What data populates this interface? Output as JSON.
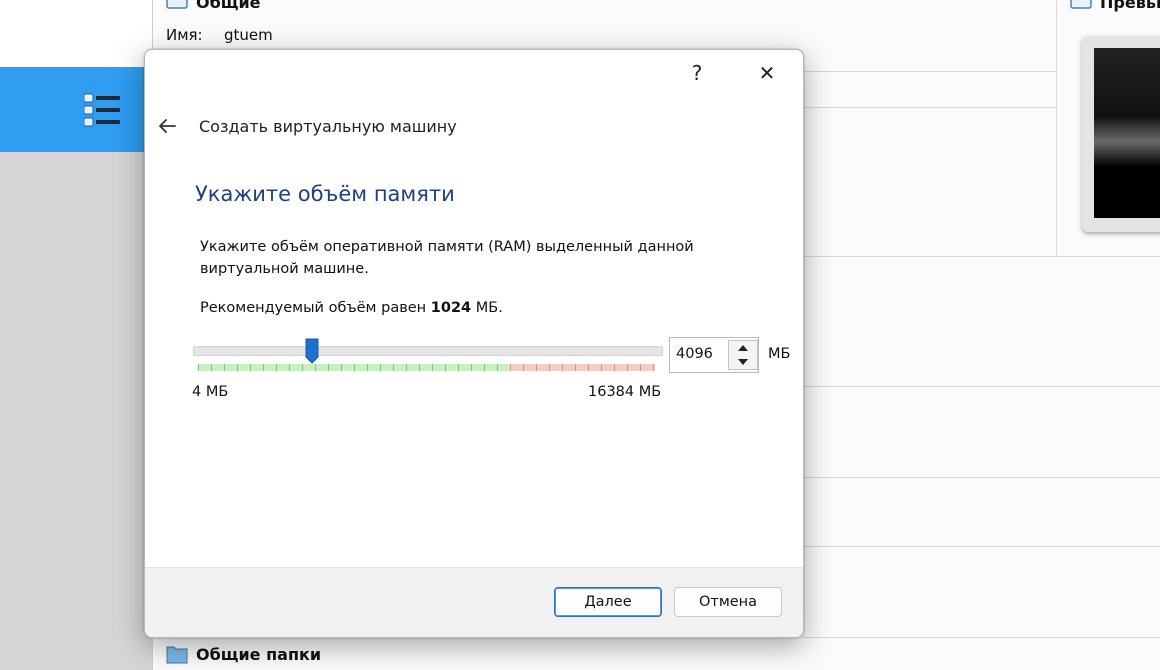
{
  "background": {
    "general_section": {
      "title": "Общие",
      "name_label": "Имя:",
      "name_value": "gtuem"
    },
    "preview_section": {
      "title": "Превью"
    },
    "shared_folders_section": {
      "title": "Общие папки"
    },
    "toolbar_accent_color": "#2f9df2"
  },
  "dialog": {
    "help_label": "?",
    "close_label": "✕",
    "wizard_title": "Создать виртуальную машину",
    "heading": "Укажите объём памяти",
    "description": "Укажите объём оперативной памяти (RAM) выделенный данной виртуальной машине.",
    "recommend_prefix": "Рекомендуемый объём равен ",
    "recommend_value": "1024",
    "recommend_suffix": " МБ.",
    "memory": {
      "value": "4096",
      "unit": "МБ",
      "min_label": "4 МБ",
      "max_label": "16384 МБ",
      "min": 4,
      "max": 16384,
      "current": 4096
    },
    "buttons": {
      "next": "Далее",
      "cancel": "Отмена"
    },
    "heading_color": "#1d3f84",
    "handle_color": "#1f6fcf"
  }
}
